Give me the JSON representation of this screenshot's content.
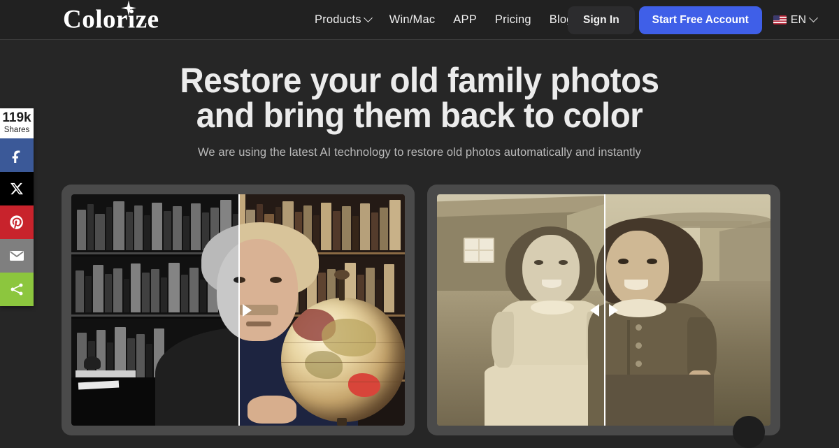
{
  "brand": {
    "name": "Colorize",
    "star_icon": "sparkle-icon"
  },
  "header": {
    "nav": [
      {
        "label": "Products",
        "has_dropdown": true
      },
      {
        "label": "Win/Mac",
        "has_dropdown": false
      },
      {
        "label": "APP",
        "has_dropdown": false
      },
      {
        "label": "Pricing",
        "has_dropdown": false
      },
      {
        "label": "Blog",
        "has_dropdown": false
      }
    ],
    "sign_in_label": "Sign In",
    "cta_label": "Start Free Account",
    "language": {
      "code": "EN",
      "flag": "us-flag-icon"
    },
    "colors": {
      "cta_blue": "#3f5fe8",
      "sign_in_bg": "#2c2c2e",
      "header_bg": "#212121"
    }
  },
  "share_rail": {
    "count": "119k",
    "count_label": "Shares",
    "buttons": [
      {
        "name": "facebook",
        "icon": "facebook-icon",
        "color": "#3b5998"
      },
      {
        "name": "x-twitter",
        "icon": "x-twitter-icon",
        "color": "#000000"
      },
      {
        "name": "pinterest",
        "icon": "pinterest-icon",
        "color": "#c8232c"
      },
      {
        "name": "email",
        "icon": "email-icon",
        "color": "#7f7f7f"
      },
      {
        "name": "share",
        "icon": "share-nodes-icon",
        "color": "#8cc63e"
      }
    ]
  },
  "hero": {
    "title_line1": "Restore your old family photos",
    "title_line2": "and bring them back to color",
    "subtitle": "We are using the latest AI technology to restore old photos automatically and instantly"
  },
  "cards": [
    {
      "name": "einstein-before-after",
      "alt": "Black and white portrait of Albert Einstein in a library restored to color",
      "divider_percent": 50,
      "handles": [
        "right"
      ]
    },
    {
      "name": "two-girls-before-after",
      "alt": "Vintage sepia photo of two young girls in front of a barn, restored",
      "divider_percent": 50,
      "handles": [
        "left",
        "right"
      ]
    }
  ],
  "page": {
    "background": "#262626",
    "card_frame": "#4a4a4a"
  }
}
